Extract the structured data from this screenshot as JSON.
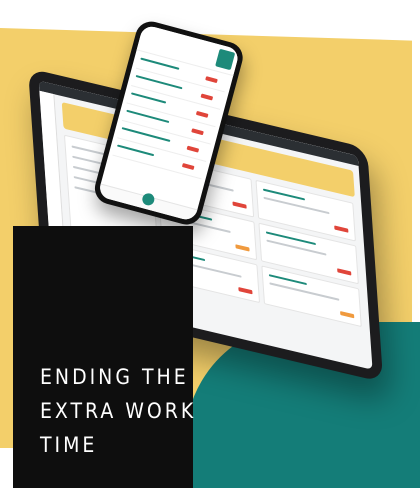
{
  "headline": {
    "line1": "ENDING THE",
    "line2": "EXTRA WORK",
    "line3": "TIME"
  },
  "colors": {
    "yellow": "#f3cf6a",
    "teal": "#147d78",
    "black": "#0e0e0e",
    "accent_green": "#1d8a7a",
    "alert_red": "#e0453a"
  },
  "devices": {
    "tablet_icon": "tablet-app-icon",
    "phone_icon": "phone-app-icon"
  }
}
